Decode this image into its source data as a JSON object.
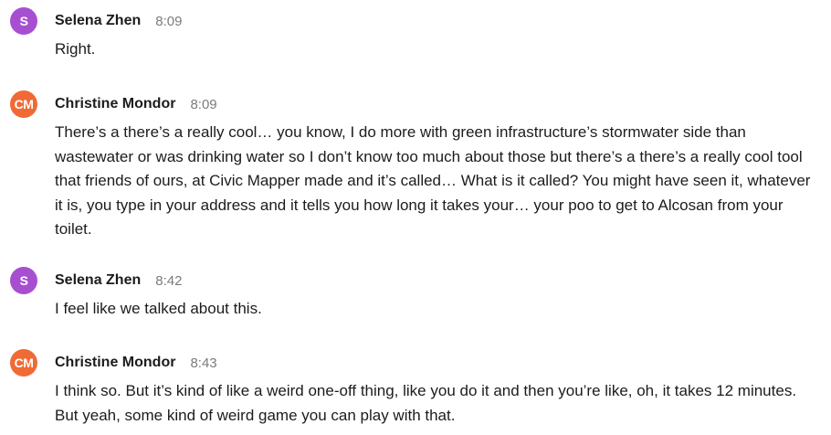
{
  "colors": {
    "avatar_purple": "#a74fd1",
    "avatar_orange": "#f06a35",
    "text": "#1d1c1d",
    "timestamp": "#7b7b7b"
  },
  "messages": [
    {
      "avatar_initials": "S",
      "author": "Selena Zhen",
      "time": "8:09",
      "text": "Right."
    },
    {
      "avatar_initials": "CM",
      "author": "Christine Mondor",
      "time": "8:09",
      "text": "There’s a there’s a really cool… you know, I do more with green infrastructure’s stormwater side than wastewater or was drinking water so I don’t know too much about those but there’s a there’s a really cool tool that friends of ours, at Civic Mapper made and it’s called… What is it called? You might have seen it, whatever it is, you type in your address and it tells you how long it takes your… your poo to get to Alcosan from your toilet."
    },
    {
      "avatar_initials": "S",
      "author": "Selena Zhen",
      "time": "8:42",
      "text": "I feel like we talked about this."
    },
    {
      "avatar_initials": "CM",
      "author": "Christine Mondor",
      "time": "8:43",
      "text": "I think so. But it’s kind of like a weird one-off thing, like you do it and then you’re like, oh, it takes 12 minutes. But yeah, some kind of weird game you can play with that."
    }
  ]
}
